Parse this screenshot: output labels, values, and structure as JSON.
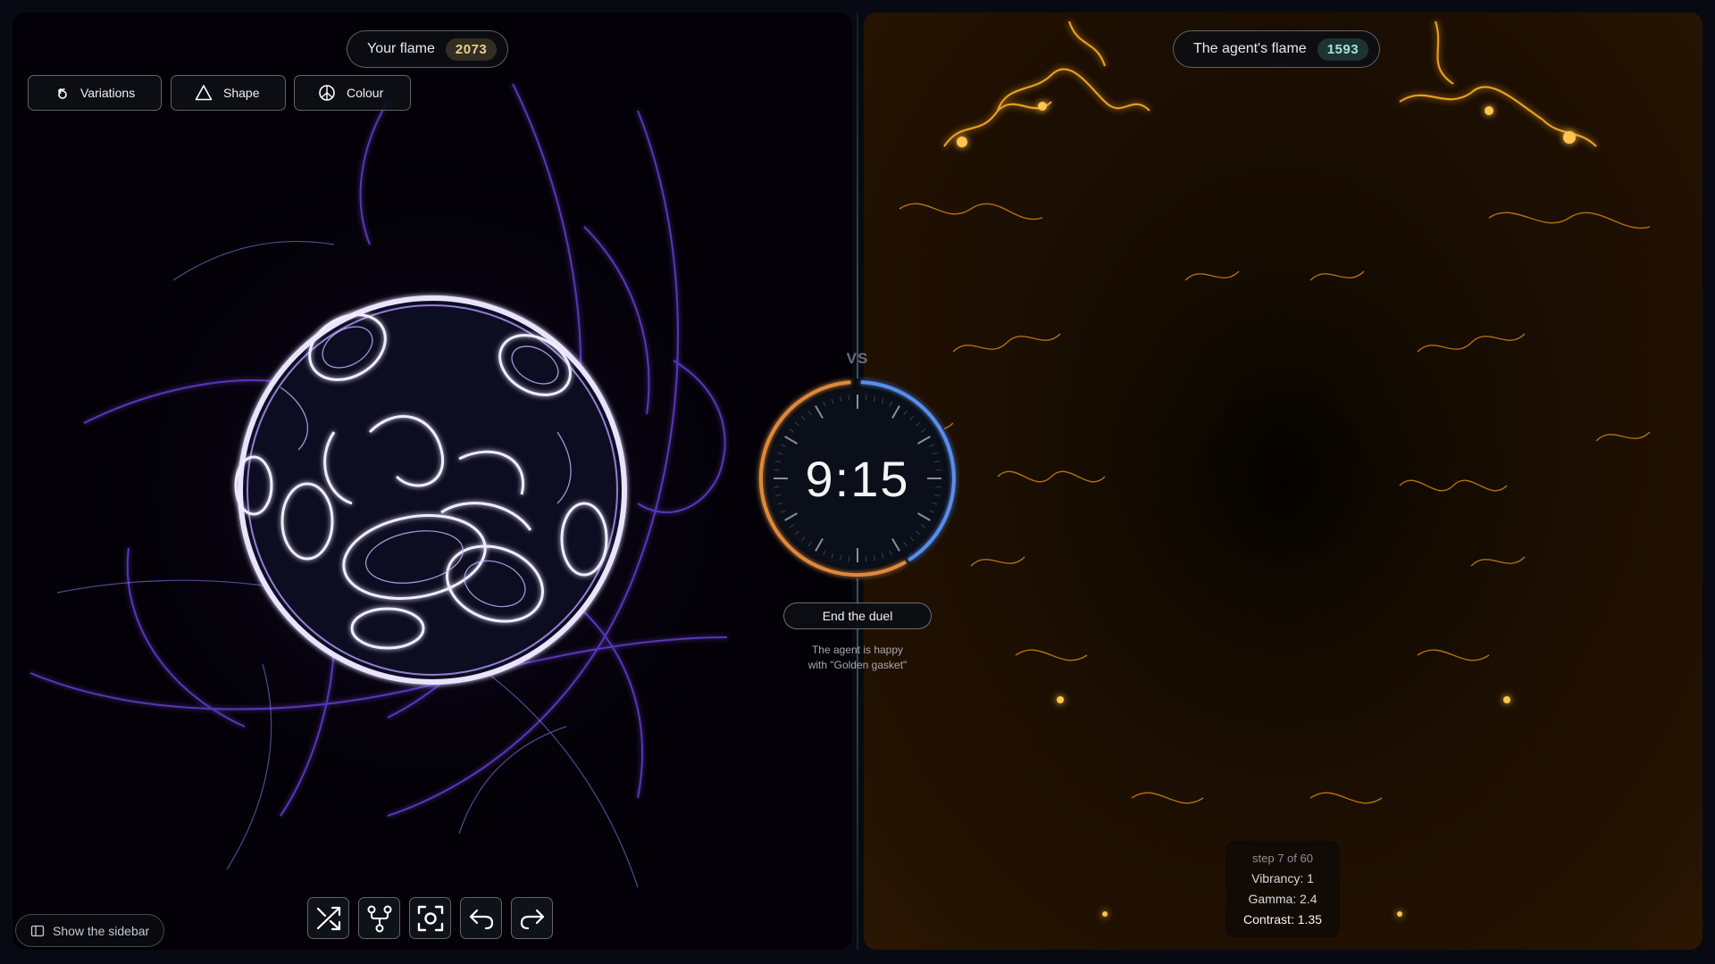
{
  "left_panel": {
    "score_label": "Your flame",
    "score_value": "2073",
    "toolbar": [
      {
        "label": "Variations",
        "icon": "spiral-icon"
      },
      {
        "label": "Shape",
        "icon": "triangle-icon"
      },
      {
        "label": "Colour",
        "icon": "colour-wheel-icon"
      }
    ],
    "sidebar_toggle_label": "Show the sidebar",
    "actions": [
      {
        "icon": "shuffle-icon"
      },
      {
        "icon": "branch-icon"
      },
      {
        "icon": "screenshot-icon"
      },
      {
        "icon": "undo-icon"
      },
      {
        "icon": "redo-icon"
      }
    ],
    "flame_color": "#8b5cf6"
  },
  "right_panel": {
    "score_label": "The agent's flame",
    "score_value": "1593",
    "flame_color": "#f59e0b",
    "stats": {
      "step": "step 7 of 60",
      "vibrancy": "Vibrancy: 1",
      "gamma": "Gamma: 2.4",
      "contrast": "Contrast: 1.35"
    }
  },
  "center": {
    "vs_label": "VS",
    "timer": "9:15",
    "end_button_label": "End the duel",
    "status_line1": "The agent is happy",
    "status_line2": "with \"Golden gasket\"",
    "ring_colors": {
      "player": "#e0893a",
      "agent": "#5b8de8"
    }
  }
}
